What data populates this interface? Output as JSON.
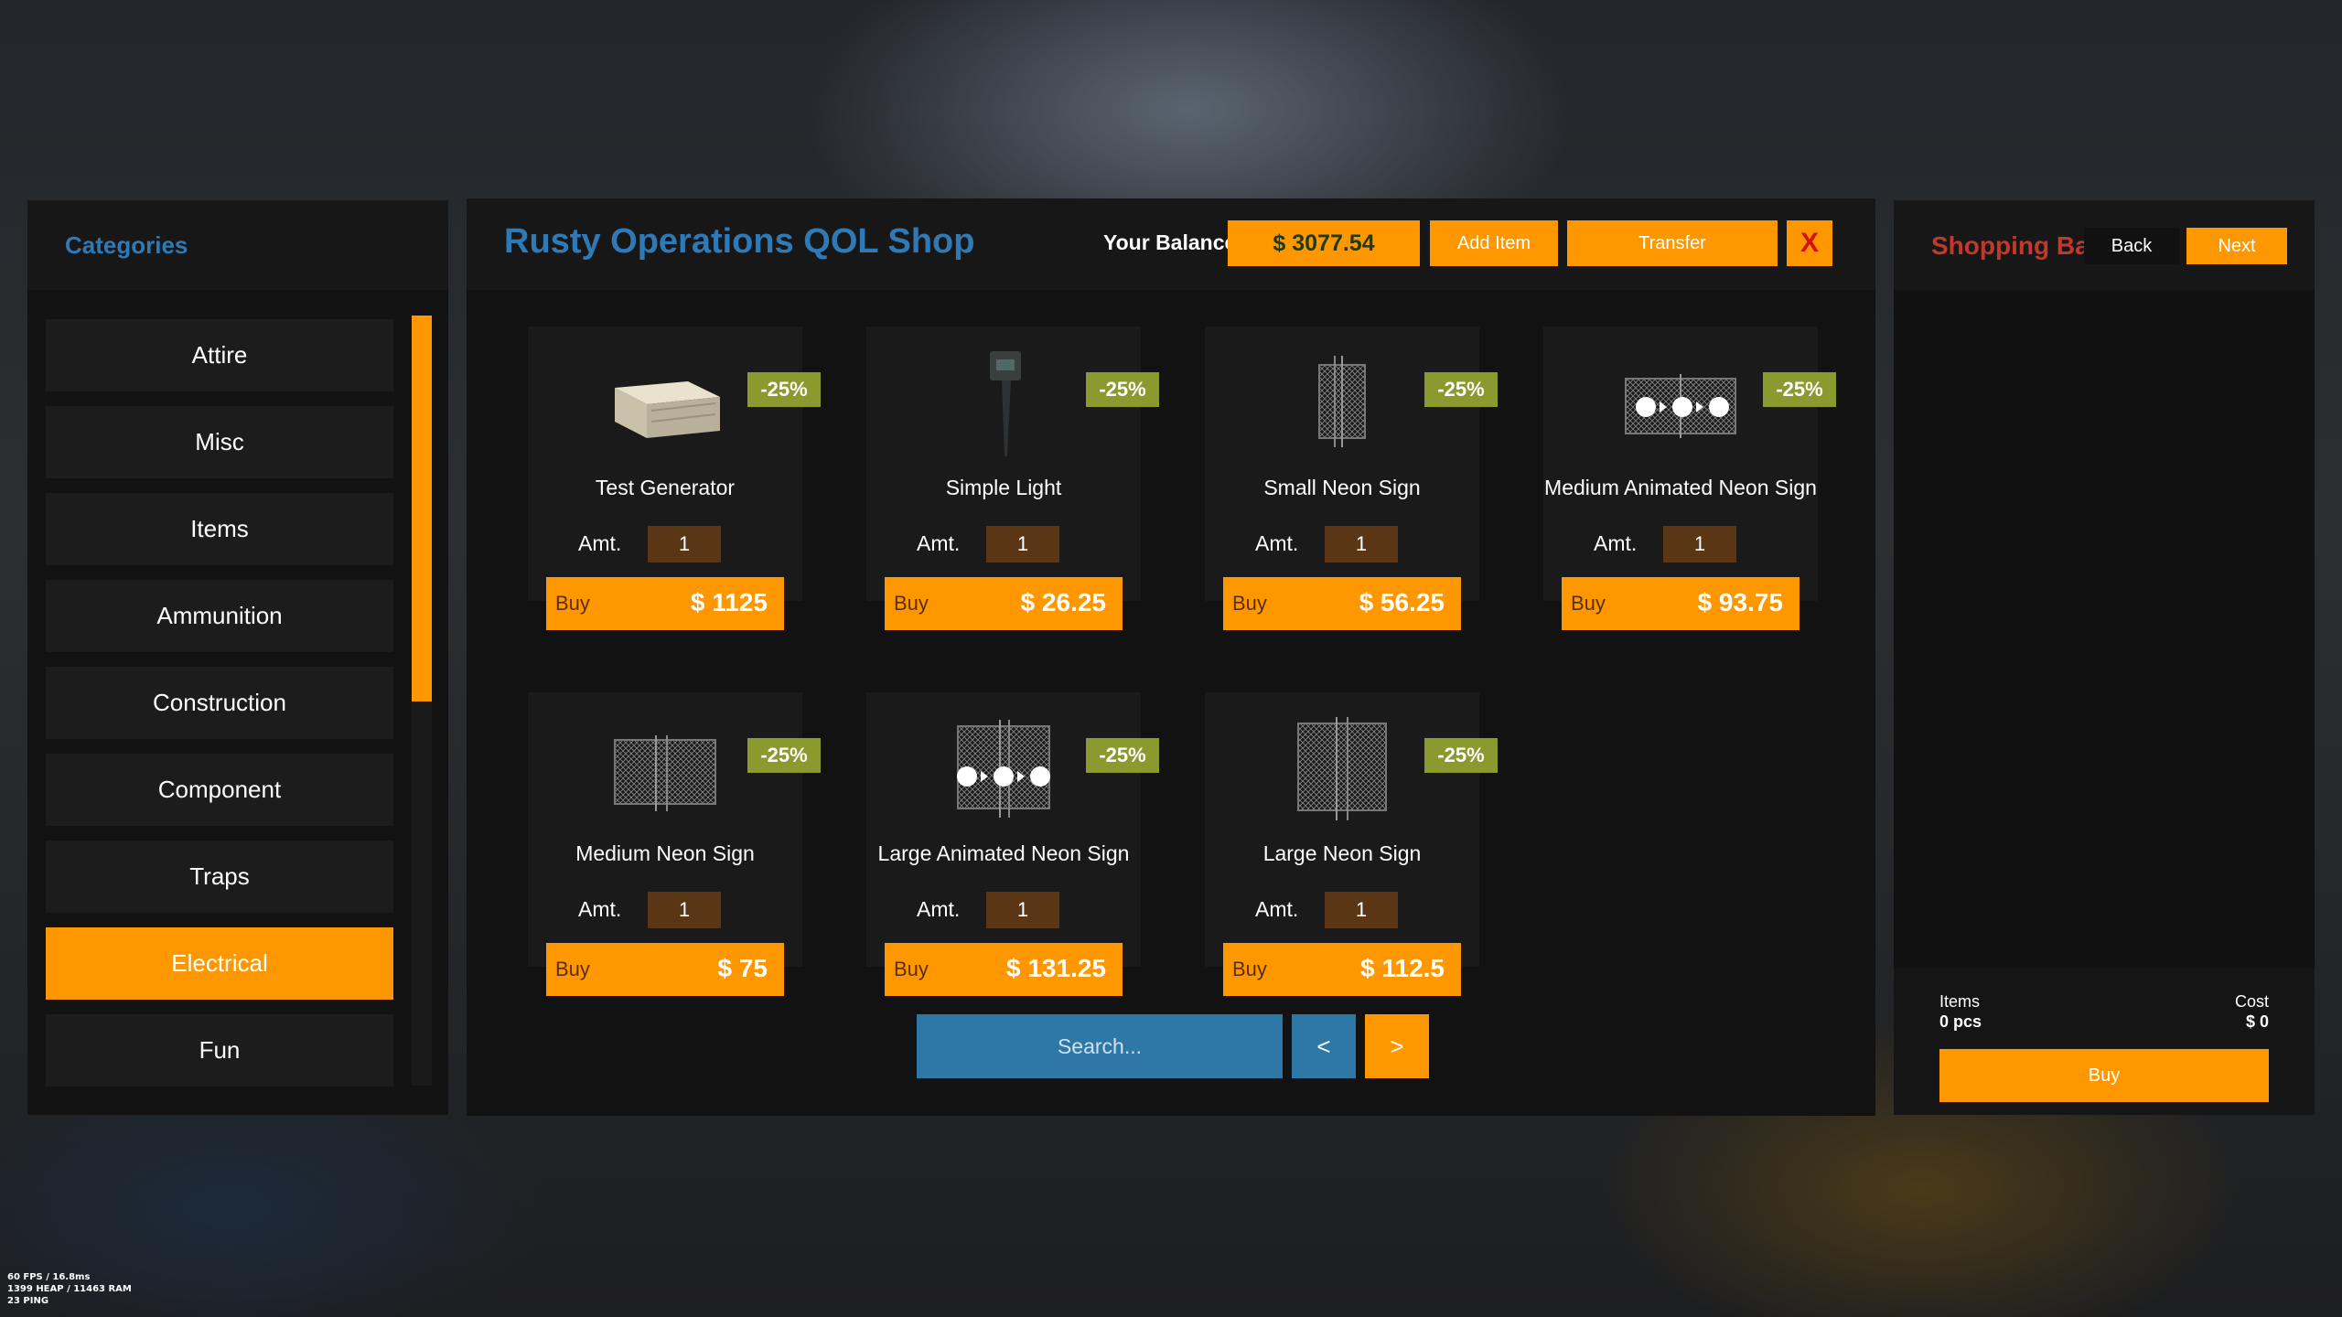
{
  "categories": {
    "title": "Categories",
    "items": [
      {
        "label": "Attire",
        "active": false
      },
      {
        "label": "Misc",
        "active": false
      },
      {
        "label": "Items",
        "active": false
      },
      {
        "label": "Ammunition",
        "active": false
      },
      {
        "label": "Construction",
        "active": false
      },
      {
        "label": "Component",
        "active": false
      },
      {
        "label": "Traps",
        "active": false
      },
      {
        "label": "Electrical",
        "active": true
      },
      {
        "label": "Fun",
        "active": false
      }
    ]
  },
  "shop": {
    "title": "Rusty Operations QOL Shop",
    "balance_label": "Your Balance",
    "balance_value": "$ 3077.54",
    "add_item_label": "Add Item",
    "transfer_label": "Transfer",
    "close_label": "X",
    "amount_label": "Amt.",
    "buy_label": "Buy",
    "products": [
      {
        "name": "Test Generator",
        "discount": "-25%",
        "amount": "1",
        "price": "$ 1125",
        "icon": "generator-icon"
      },
      {
        "name": "Simple Light",
        "discount": "-25%",
        "amount": "1",
        "price": "$ 26.25",
        "icon": "light-icon"
      },
      {
        "name": "Small Neon Sign",
        "discount": "-25%",
        "amount": "1",
        "price": "$ 56.25",
        "icon": "neon-sign-icon"
      },
      {
        "name": "Medium Animated Neon Sign",
        "discount": "-25%",
        "amount": "1",
        "price": "$ 93.75",
        "icon": "animated-neon-sign-icon"
      },
      {
        "name": "Medium Neon Sign",
        "discount": "-25%",
        "amount": "1",
        "price": "$ 75",
        "icon": "neon-sign-icon"
      },
      {
        "name": "Large Animated Neon Sign",
        "discount": "-25%",
        "amount": "1",
        "price": "$ 131.25",
        "icon": "animated-neon-sign-icon"
      },
      {
        "name": "Large Neon Sign",
        "discount": "-25%",
        "amount": "1",
        "price": "$ 112.5",
        "icon": "neon-sign-icon"
      }
    ],
    "search_placeholder": "Search...",
    "prev_label": "<",
    "next_label": ">"
  },
  "bag": {
    "title": "Shopping Bag",
    "back_label": "Back",
    "next_label": "Next",
    "items_label": "Items",
    "items_value": "0 pcs",
    "cost_label": "Cost",
    "cost_value": "$ 0",
    "buy_label": "Buy"
  },
  "perf": {
    "line1": "60 FPS / 16.8ms",
    "line2": "1399 HEAP / 11463 RAM",
    "line3": "23 PING"
  },
  "colors": {
    "accent": "#ff9800",
    "title_blue": "#2f7ab6",
    "discount_green": "#8a9a2e",
    "bag_title_red": "#c0392b",
    "close_red": "#d51010"
  }
}
